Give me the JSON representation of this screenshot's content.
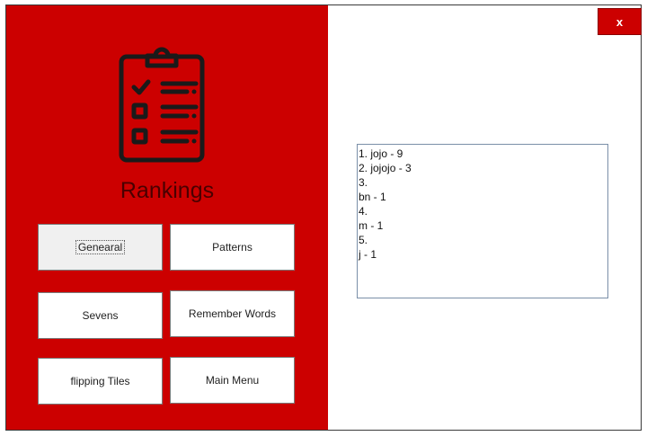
{
  "close_label": "x",
  "title": "Rankings",
  "buttons": {
    "general": "Genearal",
    "patterns": "Patterns",
    "sevens": "Sevens",
    "remember_words": "Remember Words",
    "flipping_tiles": "flipping Tiles",
    "main_menu": "Main Menu"
  },
  "rankings": [
    "1. jojo - 9",
    "2. jojojo - 3",
    "3.",
    "bn - 1",
    "4.",
    "m - 1",
    "5.",
    "j - 1"
  ],
  "icon": "clipboard-checklist-icon",
  "colors": {
    "panel": "#cc0000",
    "icon": "#1a1a1a"
  }
}
